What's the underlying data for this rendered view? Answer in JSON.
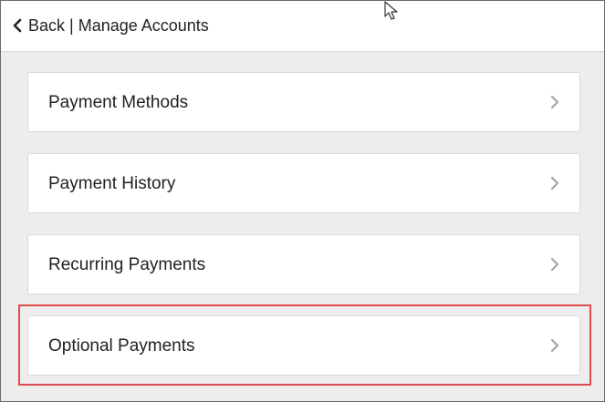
{
  "header": {
    "back_label": "Back | Manage Accounts",
    "back_icon": "chevron-left-icon"
  },
  "menu": {
    "items": [
      {
        "label": "Payment Methods",
        "icon": "chevron-right-icon"
      },
      {
        "label": "Payment History",
        "icon": "chevron-right-icon"
      },
      {
        "label": "Recurring Payments",
        "icon": "chevron-right-icon"
      },
      {
        "label": "Optional Payments",
        "icon": "chevron-right-icon"
      }
    ]
  },
  "annotation": {
    "highlight_color": "#e14a4a",
    "highlighted_item": "Optional Payments"
  },
  "colors": {
    "background": "#ededed",
    "card": "#ffffff",
    "chevron": "#a6a6a6"
  }
}
